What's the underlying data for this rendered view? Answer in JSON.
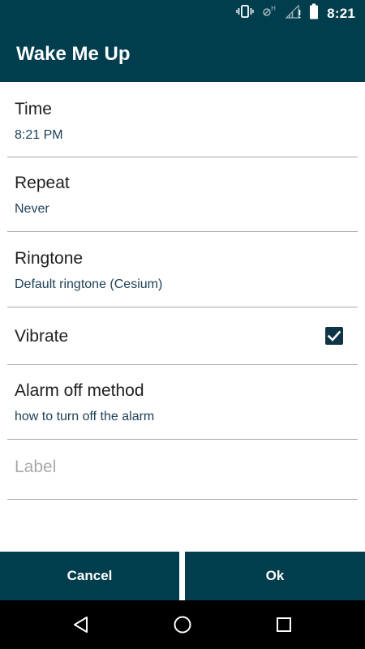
{
  "status_bar": {
    "time": "8:21",
    "icons": [
      "vibrate-icon",
      "no-sim-icon",
      "signal-icon",
      "battery-icon"
    ]
  },
  "app_bar": {
    "title": "Wake Me Up"
  },
  "settings": {
    "time": {
      "title": "Time",
      "value": "8:21 PM"
    },
    "repeat": {
      "title": "Repeat",
      "value": "Never"
    },
    "ringtone": {
      "title": "Ringtone",
      "value": "Default ringtone (Cesium)"
    },
    "vibrate": {
      "title": "Vibrate",
      "checked": true
    },
    "alarm_off": {
      "title": "Alarm off method",
      "value": "how to turn off the alarm"
    },
    "label": {
      "placeholder": "Label",
      "value": ""
    }
  },
  "buttons": {
    "cancel": "Cancel",
    "ok": "Ok"
  },
  "nav": {
    "icons": [
      "back-icon",
      "home-icon",
      "recents-icon"
    ]
  },
  "colors": {
    "primary": "#003d4d",
    "subtitle": "#1b3f57",
    "divider": "#a8a8a8",
    "placeholder": "#a9a9a9"
  }
}
